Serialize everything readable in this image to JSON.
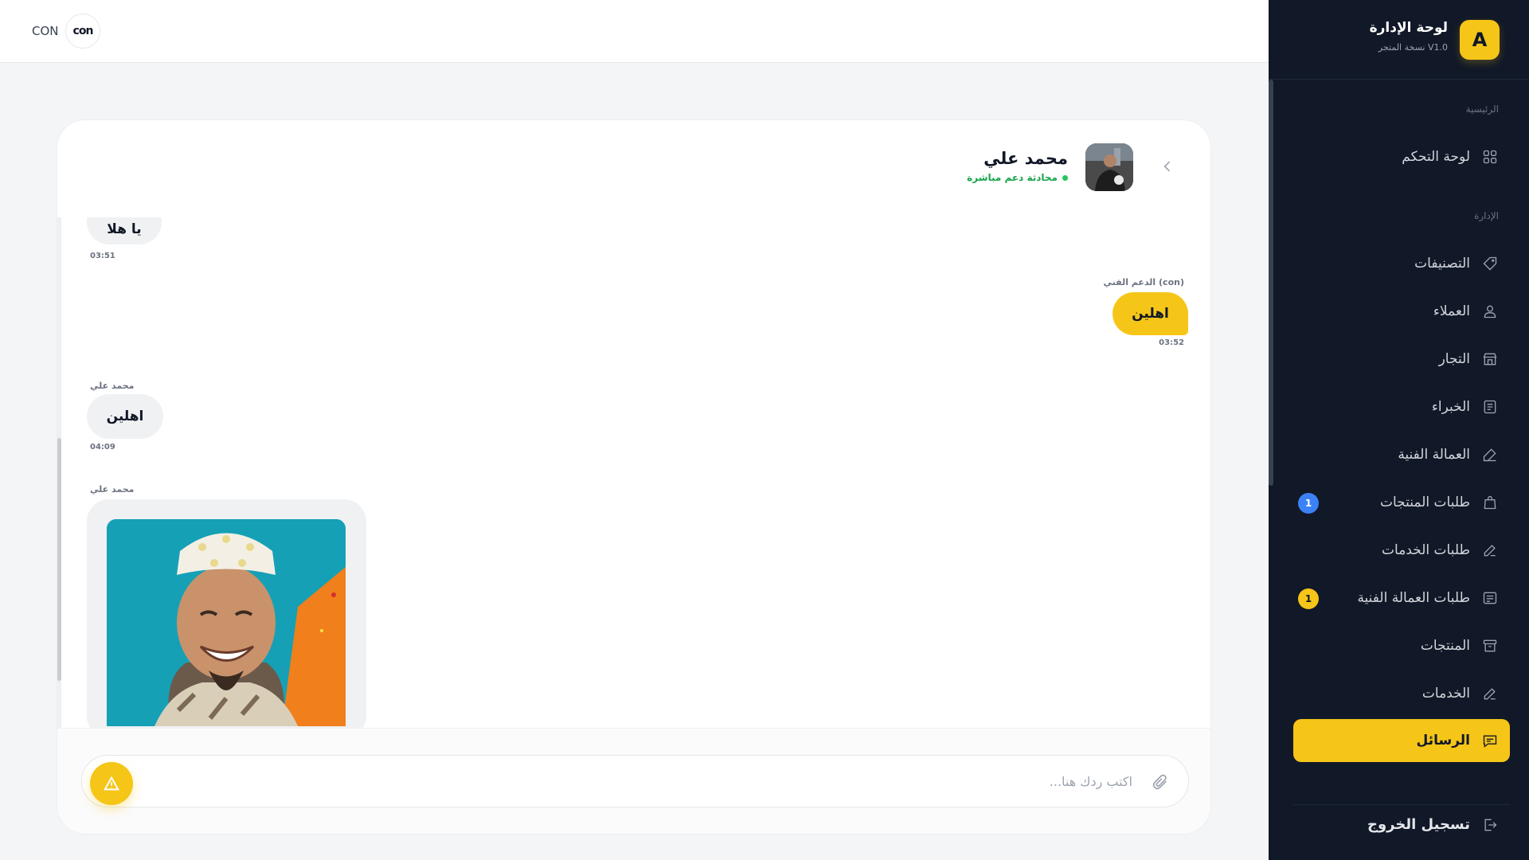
{
  "colors": {
    "accent": "#f5c518",
    "sidebar_bg": "#111827",
    "online": "#22c55e",
    "badge_blue": "#3b82f6"
  },
  "topbar": {
    "logo_text": "CON",
    "logo_mark": "con"
  },
  "sidebar": {
    "brand_letter": "A",
    "brand_title": "لوحة الإدارة",
    "brand_sub": "نسخة المتجر V1.0",
    "section_main": "الرئيسية",
    "section_admin": "الإدارة",
    "items": [
      {
        "label": "لوحة التحكم",
        "icon": "grid-icon"
      },
      {
        "label": "التصنيفات",
        "icon": "tag-icon"
      },
      {
        "label": "العملاء",
        "icon": "user-icon"
      },
      {
        "label": "التجار",
        "icon": "store-icon"
      },
      {
        "label": "الخبراء",
        "icon": "document-icon"
      },
      {
        "label": "العمالة الفنية",
        "icon": "tool-icon"
      },
      {
        "label": "طلبات المنتجات",
        "icon": "bag-icon",
        "badge": "1"
      },
      {
        "label": "طلبات الخدمات",
        "icon": "edit-icon"
      },
      {
        "label": "طلبات العمالة الفنية",
        "icon": "list-icon",
        "badge": "1"
      },
      {
        "label": "المنتجات",
        "icon": "archive-icon"
      },
      {
        "label": "الخدمات",
        "icon": "edit-icon"
      },
      {
        "label": "الرسائل",
        "icon": "chat-icon"
      }
    ],
    "logout": "تسجيل الخروج"
  },
  "chat": {
    "user_name": "محمد علي",
    "user_status": "محادثة دعم مباشرة",
    "messages": [
      {
        "direction": "in",
        "text": "يا هلا",
        "time": "03:51"
      },
      {
        "direction": "out",
        "sender": "الدعم الفني (con)",
        "text": "اهلين",
        "time": "03:52"
      },
      {
        "direction": "in",
        "sender": "محمد علي",
        "text": "اهلين",
        "time": "04:09"
      },
      {
        "direction": "in",
        "sender": "محمد علي",
        "type": "image"
      }
    ],
    "composer_placeholder": "اكتب ردك هنا..."
  }
}
